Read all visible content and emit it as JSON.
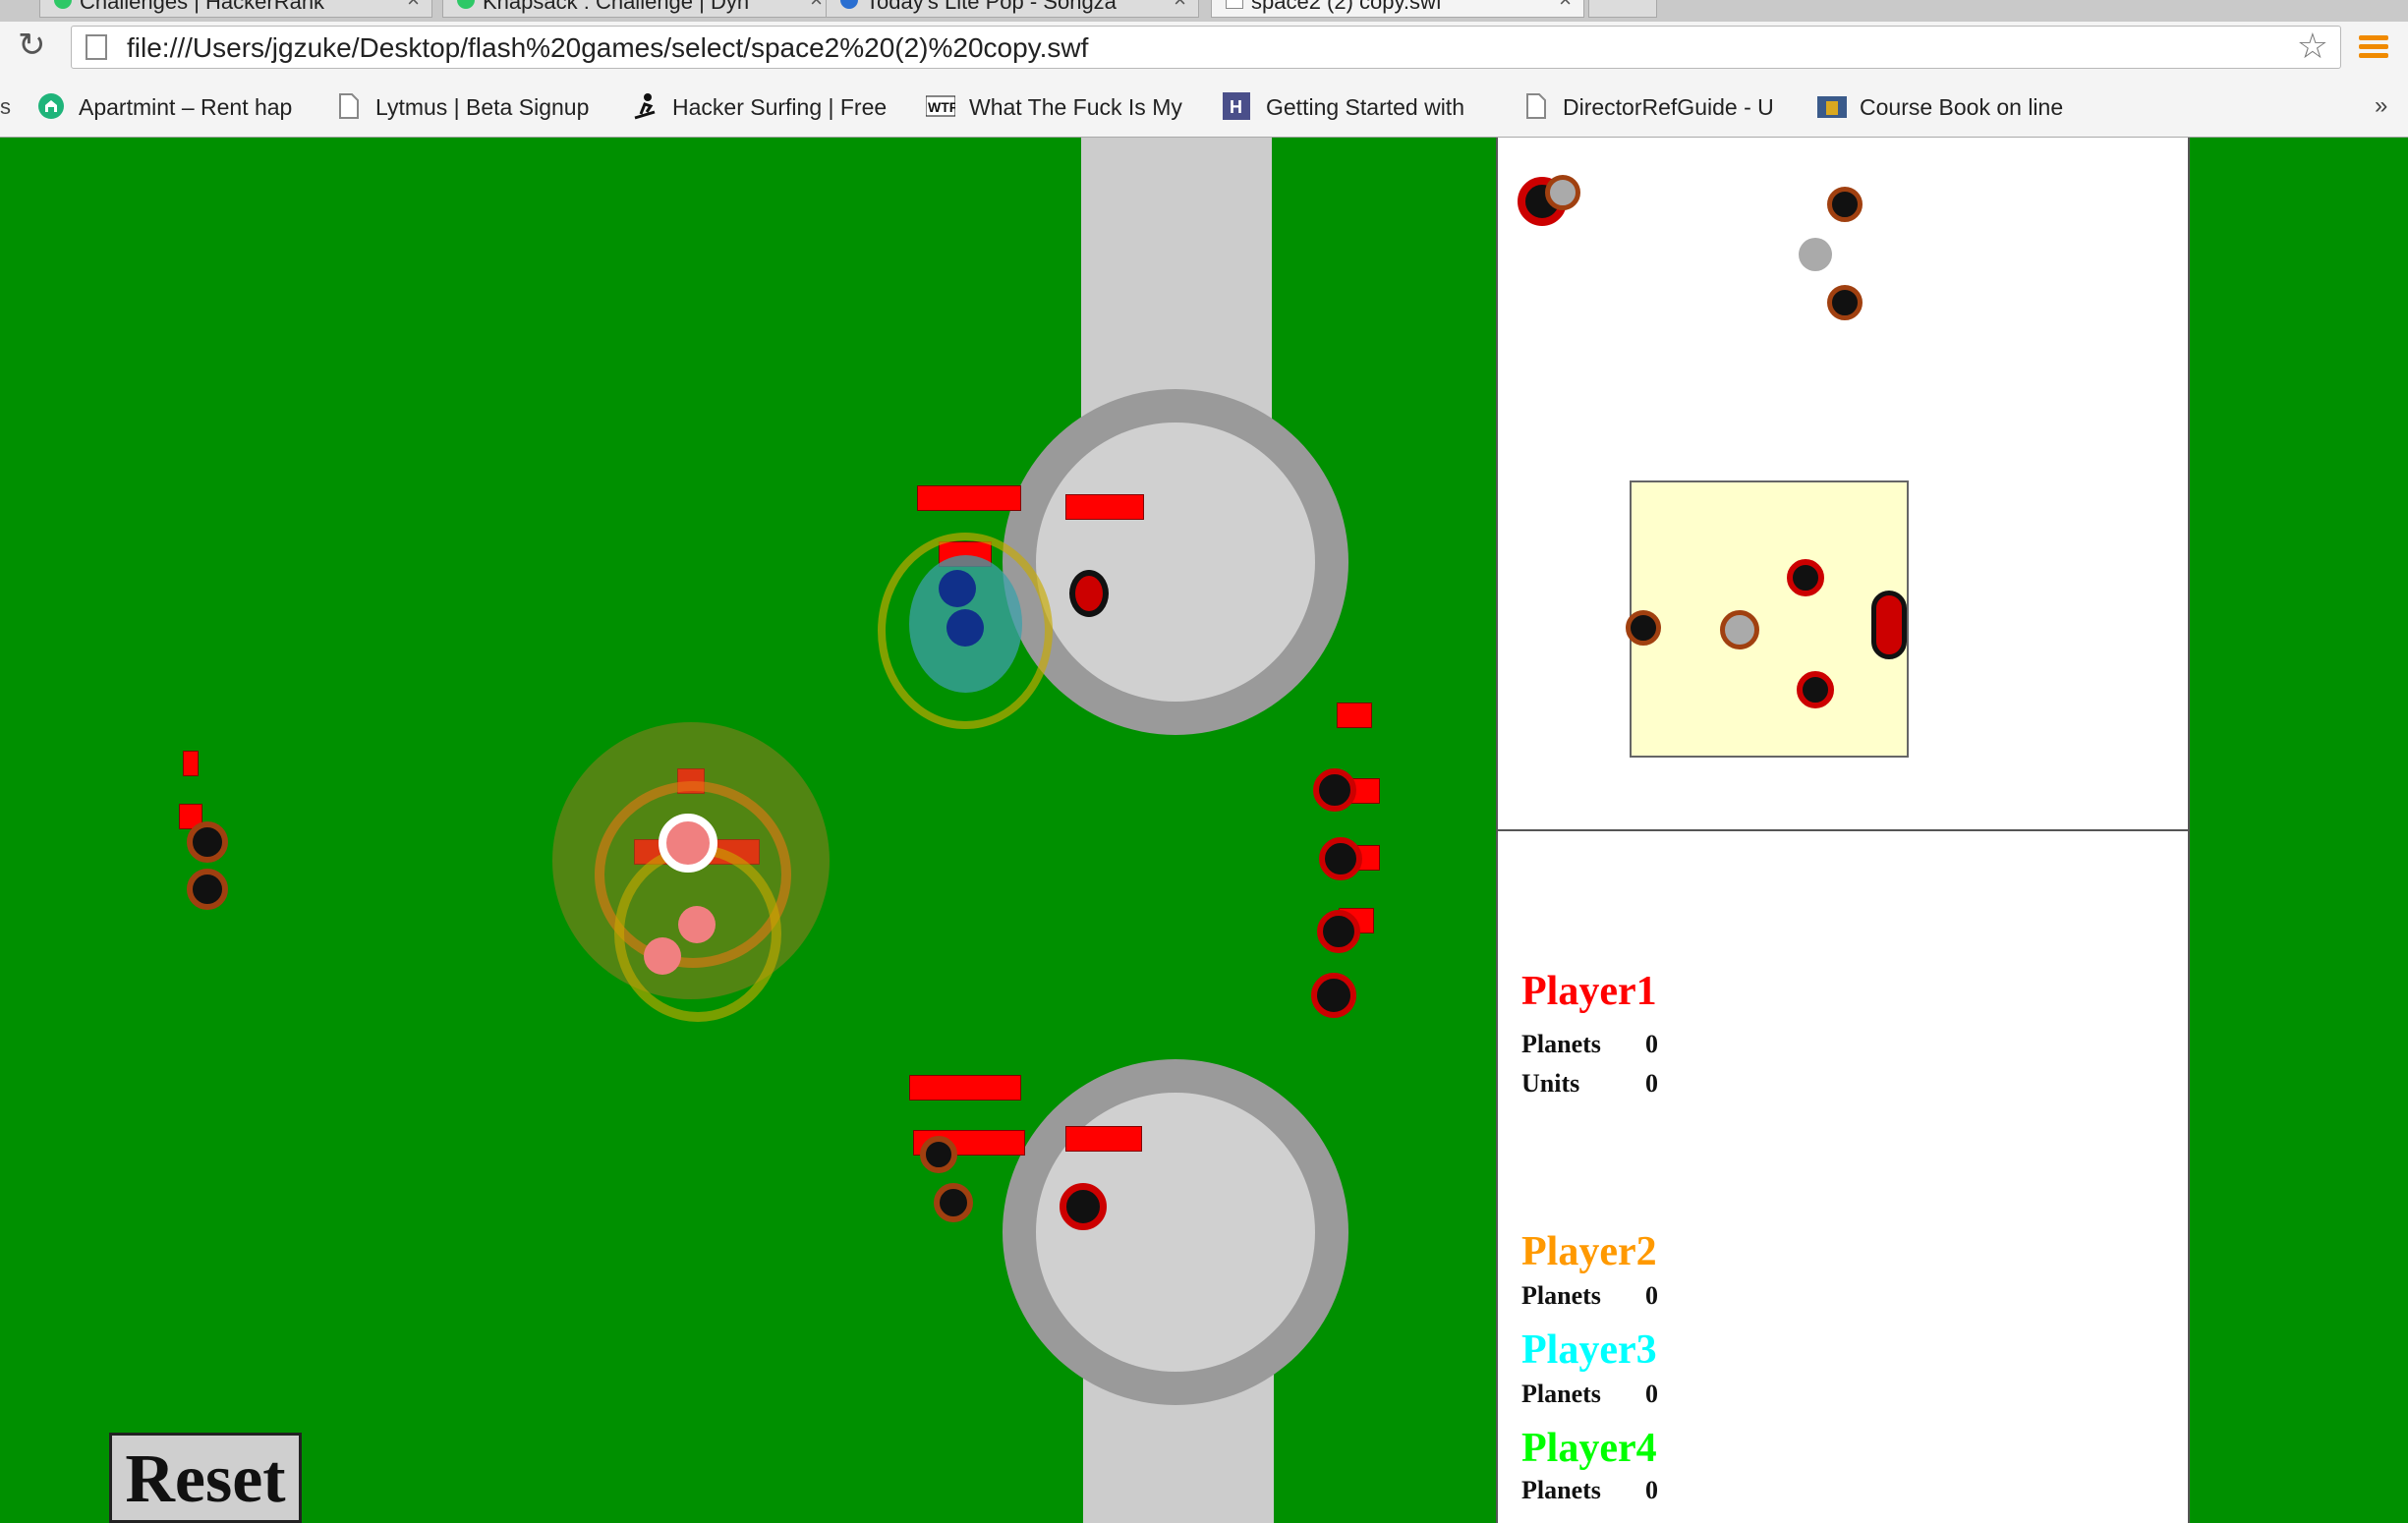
{
  "browser": {
    "tabs": [
      {
        "title": "Challenges | HackerRank",
        "favicon_color": "#2ec866",
        "active": false
      },
      {
        "title": "Knapsack : Challenge | Dyn",
        "favicon_color": "#2ec866",
        "active": false
      },
      {
        "title": "Today's Lite Pop - Songza",
        "favicon_color": "#2a6fd1",
        "active": false
      },
      {
        "title": "space2 (2) copy.swf",
        "favicon_color": "#ffffff",
        "active": true
      }
    ],
    "url": "file:///Users/jgzuke/Desktop/flash%20games/select/space2%20(2)%20copy.swf",
    "bookmarks": [
      {
        "label": "Apartmint – Rent hap",
        "icon": "apartmint-icon"
      },
      {
        "label": "Lytmus | Beta Signup",
        "icon": "page-icon"
      },
      {
        "label": "Hacker Surfing | Free",
        "icon": "surfer-icon"
      },
      {
        "label": "What The Fuck Is My",
        "icon": "wtf-icon"
      },
      {
        "label": "Getting Started with",
        "icon": "h-icon"
      },
      {
        "label": "DirectorRefGuide - U",
        "icon": "page-icon"
      },
      {
        "label": "Course Book on line",
        "icon": "book-icon"
      }
    ],
    "bookmarks_overflow": "»"
  },
  "game": {
    "reset_label": "Reset",
    "players": [
      {
        "name": "Player1",
        "color": "#ff0000",
        "stats": [
          {
            "label": "Planets",
            "value": "0"
          },
          {
            "label": "Units",
            "value": "0"
          }
        ]
      },
      {
        "name": "Player2",
        "color": "#ff9900",
        "stats": [
          {
            "label": "Planets",
            "value": "0"
          }
        ]
      },
      {
        "name": "Player3",
        "color": "#00ffff",
        "stats": [
          {
            "label": "Planets",
            "value": "0"
          }
        ]
      },
      {
        "name": "Player4",
        "color": "#00ff00",
        "stats": [
          {
            "label": "Planets",
            "value": "0"
          }
        ]
      }
    ]
  },
  "colors": {
    "field": "#009000",
    "planet": "#d0d0d0",
    "planet_ring": "#9a9a9a",
    "health_bar": "#ff0000",
    "minimap_selection": "#ffffcc"
  }
}
